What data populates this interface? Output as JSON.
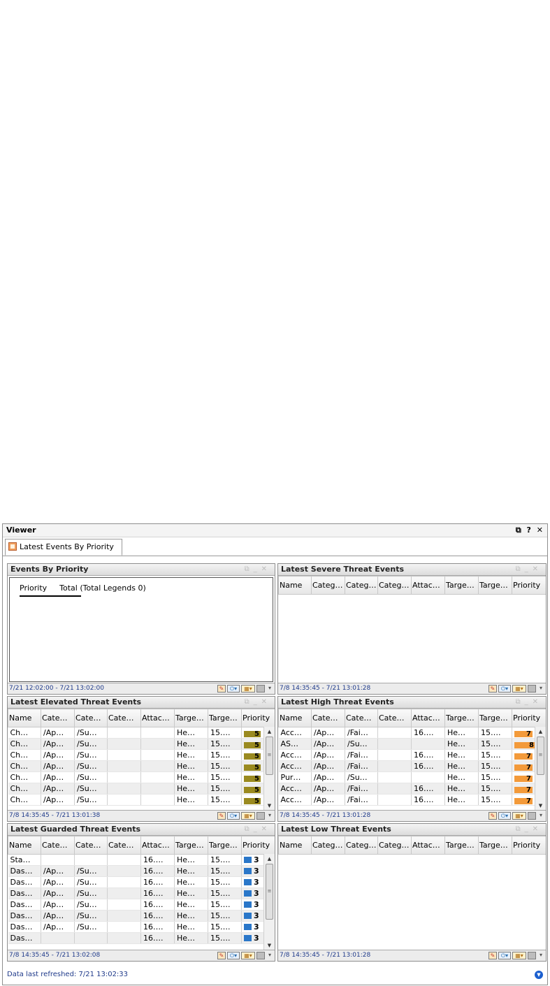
{
  "viewer": {
    "title": "Viewer",
    "controls": "⧉ ? ✕",
    "tab_label": "Latest Events By Priority",
    "status_text": "Data last refreshed: 7/21 13:02:33"
  },
  "colors": {
    "elevated": "#9a8a20",
    "high": "#f39a3a",
    "guarded": "#2a77c9"
  },
  "panels": {
    "events_by_priority": {
      "title": "Events By Priority",
      "legend_col1": "Priority",
      "legend_col2": "Total (Total Legends 0)",
      "footer": "7/21 12:02:00 - 7/21 13:02:00"
    },
    "severe": {
      "title": "Latest Severe Threat Events",
      "columns": [
        "Name",
        "Categ…",
        "Categ…",
        "Categ…",
        "Attac…",
        "Targe…",
        "Targe…",
        "Priority"
      ],
      "footer": "7/8 14:35:45 - 7/21 13:01:28"
    },
    "elevated": {
      "title": "Latest Elevated Threat Events",
      "columns": [
        "Name",
        "Cate…",
        "Cate…",
        "Cate…",
        "Attac…",
        "Targe…",
        "Targe…",
        "Priority"
      ],
      "rows": [
        [
          "Ch…",
          "/Ap…",
          "/Su…",
          "",
          "",
          "He…",
          "15….",
          "5"
        ],
        [
          "Ch…",
          "/Ap…",
          "/Su…",
          "",
          "",
          "He…",
          "15….",
          "5"
        ],
        [
          "Ch…",
          "/Ap…",
          "/Su…",
          "",
          "",
          "He…",
          "15….",
          "5"
        ],
        [
          "Ch…",
          "/Ap…",
          "/Su…",
          "",
          "",
          "He…",
          "15….",
          "5"
        ],
        [
          "Ch…",
          "/Ap…",
          "/Su…",
          "",
          "",
          "He…",
          "15….",
          "5"
        ],
        [
          "Ch…",
          "/Ap…",
          "/Su…",
          "",
          "",
          "He…",
          "15….",
          "5"
        ],
        [
          "Ch…",
          "/Ap…",
          "/Su…",
          "",
          "",
          "He…",
          "15….",
          "5"
        ]
      ],
      "footer": "7/8 14:35:45 - 7/21 13:01:38"
    },
    "high": {
      "title": "Latest High Threat Events",
      "columns": [
        "Name",
        "Cate…",
        "Cate…",
        "Cate…",
        "Attac…",
        "Targe…",
        "Targe…",
        "Priority"
      ],
      "rows": [
        [
          "Acc…",
          "/Ap…",
          "/Fai…",
          "",
          "16….",
          "He…",
          "15….",
          "7"
        ],
        [
          "AS…",
          "/Ap…",
          "/Su…",
          "",
          "",
          "He…",
          "15….",
          "8"
        ],
        [
          "Acc…",
          "/Ap…",
          "/Fai…",
          "",
          "16….",
          "He…",
          "15….",
          "7"
        ],
        [
          "Acc…",
          "/Ap…",
          "/Fai…",
          "",
          "16….",
          "He…",
          "15….",
          "7"
        ],
        [
          "Pur…",
          "/Ap…",
          "/Su…",
          "",
          "",
          "He…",
          "15….",
          "7"
        ],
        [
          "Acc…",
          "/Ap…",
          "/Fai…",
          "",
          "16….",
          "He…",
          "15….",
          "7"
        ],
        [
          "Acc…",
          "/Ap…",
          "/Fai…",
          "",
          "16….",
          "He…",
          "15….",
          "7"
        ]
      ],
      "footer": "7/8 14:35:45 - 7/21 13:01:28"
    },
    "guarded": {
      "title": "Latest Guarded Threat Events",
      "columns": [
        "Name",
        "Cate…",
        "Cate…",
        "Cate…",
        "Attac…",
        "Targe…",
        "Targe…",
        "Priority"
      ],
      "rows": [
        [
          "Sta…",
          "",
          "",
          "",
          "16….",
          "He…",
          "15….",
          "3"
        ],
        [
          "Das…",
          "/Ap…",
          "/Su…",
          "",
          "16….",
          "He…",
          "15….",
          "3"
        ],
        [
          "Das…",
          "/Ap…",
          "/Su…",
          "",
          "16….",
          "He…",
          "15….",
          "3"
        ],
        [
          "Das…",
          "/Ap…",
          "/Su…",
          "",
          "16….",
          "He…",
          "15….",
          "3"
        ],
        [
          "Das…",
          "/Ap…",
          "/Su…",
          "",
          "16….",
          "He…",
          "15….",
          "3"
        ],
        [
          "Das…",
          "/Ap…",
          "/Su…",
          "",
          "16….",
          "He…",
          "15….",
          "3"
        ],
        [
          "Das…",
          "/Ap…",
          "/Su…",
          "",
          "16….",
          "He…",
          "15….",
          "3"
        ],
        [
          "Das…",
          "",
          "",
          "",
          "16….",
          "He…",
          "15….",
          "3"
        ]
      ],
      "footer": "7/8 14:35:45 - 7/21 13:02:08"
    },
    "low": {
      "title": "Latest Low Threat Events",
      "columns": [
        "Name",
        "Categ…",
        "Categ…",
        "Categ…",
        "Attac…",
        "Targe…",
        "Targe…",
        "Priority"
      ],
      "footer": "7/8 14:35:45 - 7/21 13:01:28"
    }
  }
}
